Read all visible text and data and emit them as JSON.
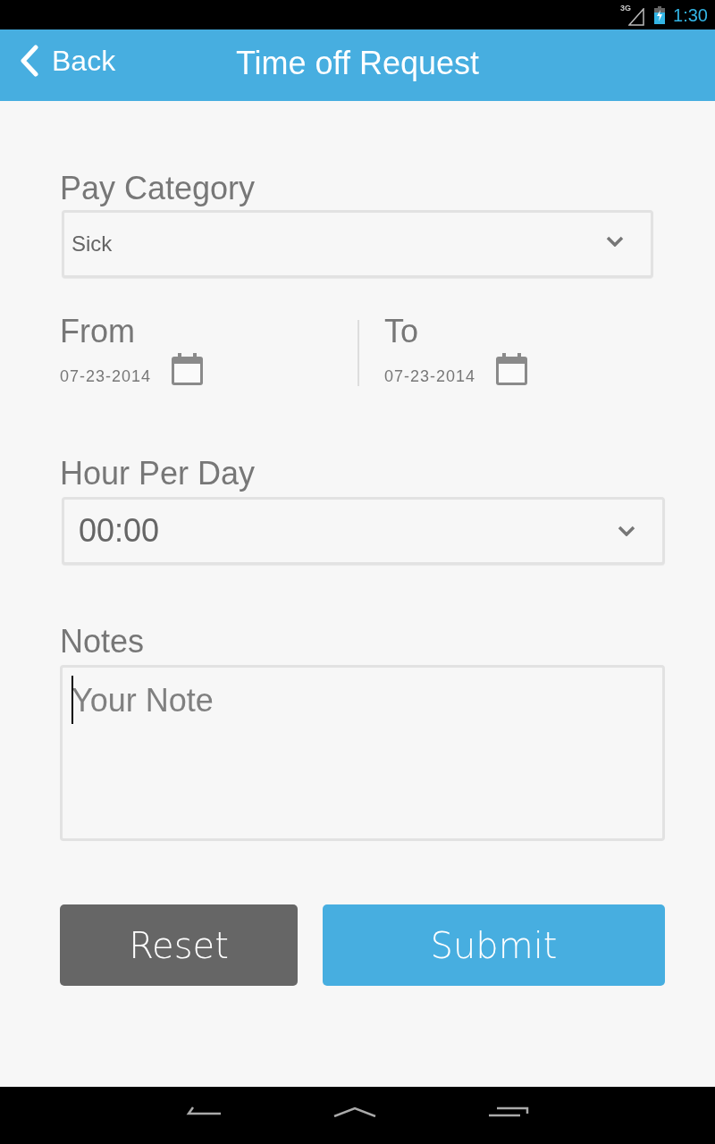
{
  "status_bar": {
    "network": "3G",
    "time": "1:30"
  },
  "app_bar": {
    "back_label": "Back",
    "title": "Time off Request"
  },
  "form": {
    "pay_category": {
      "label": "Pay Category",
      "value": "Sick"
    },
    "date_range": [
      {
        "label": "From",
        "value": "07-23-2014"
      },
      {
        "label": "To",
        "value": "07-23-2014"
      }
    ],
    "hours_per_day": {
      "label": "Hour Per Day",
      "value": "00:00"
    },
    "notes": {
      "label": "Notes",
      "placeholder": "Your Note",
      "focused": true
    }
  },
  "buttons": [
    {
      "label": "Reset",
      "kind": "secondary"
    },
    {
      "label": "Submit",
      "kind": "primary"
    }
  ]
}
